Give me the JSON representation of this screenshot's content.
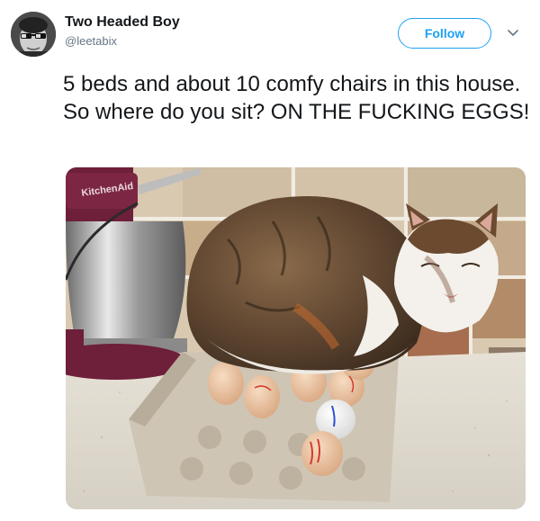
{
  "tweet": {
    "author": {
      "display_name": "Two Headed Boy",
      "handle": "@leetabix",
      "avatar_icon": "avatar-photo"
    },
    "follow_label": "Follow",
    "more_icon": "chevron-down-icon",
    "text": "5 beds and about 10 comfy chairs in this house. So where do you sit? ON THE FUCKING EGGS!",
    "photo": {
      "mixer_brand": "KitchenAid"
    }
  },
  "colors": {
    "accent": "#1da1f2",
    "text": "#14171a",
    "secondary": "#657786"
  }
}
